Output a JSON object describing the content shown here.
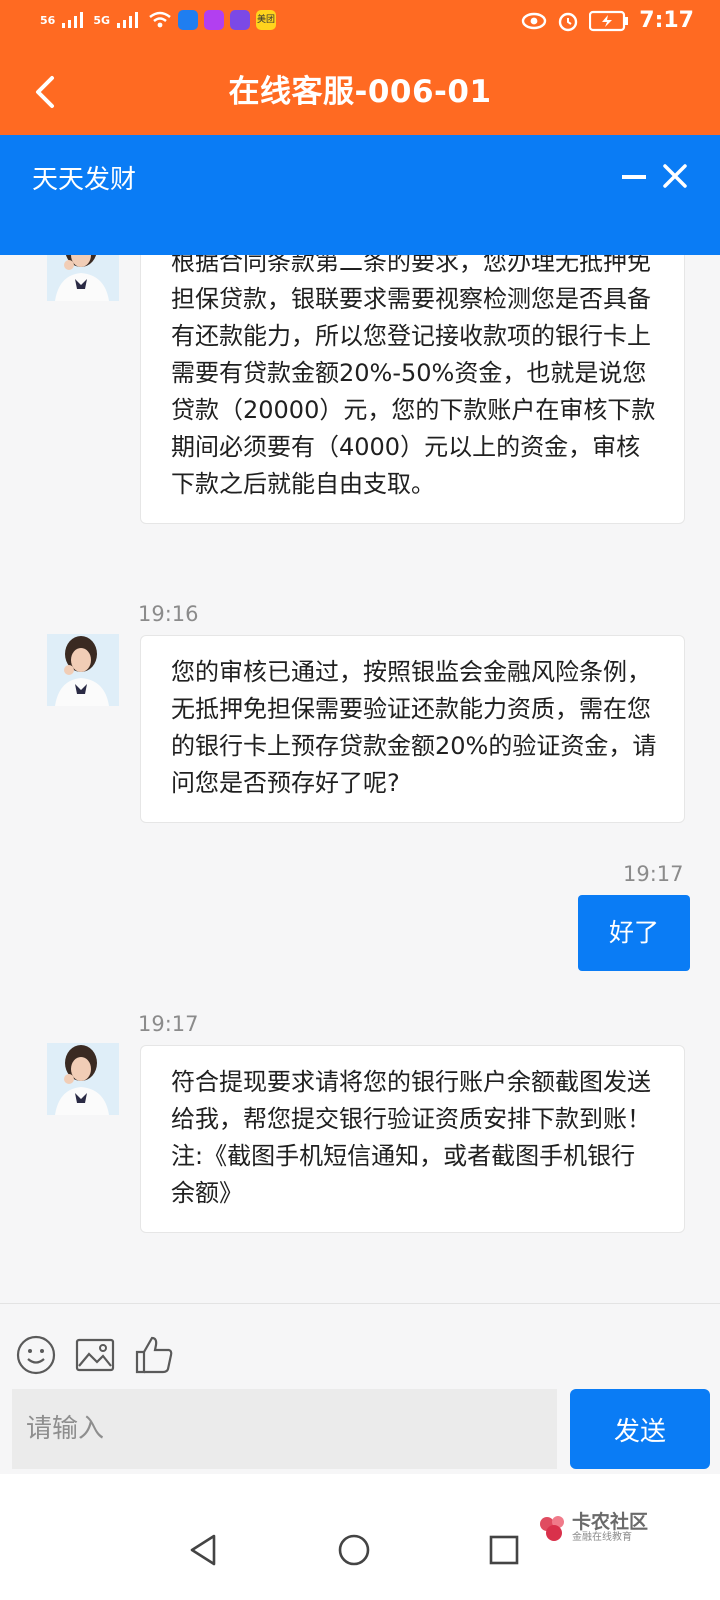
{
  "status_bar": {
    "signal_left": "56",
    "signal_right": "5G",
    "app_badge": "美团",
    "time": "7:17"
  },
  "header": {
    "title": "在线客服-006-01"
  },
  "banner": {
    "title": "天天发财"
  },
  "messages": [
    {
      "from": "agent",
      "time": "",
      "text": "根据合同条款第二条的要求，您办理无抵押免担保贷款，银联要求需要视察检测您是否具备有还款能力，所以您登记接收款项的银行卡上需要有贷款金额20%-50%资金，也就是说您贷款（20000）元，您的下款账户在审核下款期间必须要有（4000）元以上的资金，审核下款之后就能自由支取。"
    },
    {
      "from": "agent",
      "time": "19:16",
      "text": "您的审核已通过，按照银监会金融风险条例，无抵押免担保需要验证还款能力资质，需在您的银行卡上预存贷款金额20%的验证资金，请问您是否预存好了呢?"
    },
    {
      "from": "user",
      "time": "19:17",
      "text": "好了"
    },
    {
      "from": "agent",
      "time": "19:17",
      "text": "符合提现要求请将您的银行账户余额截图发送给我，帮您提交银行验证资质安排下款到账！注:《截图手机短信通知，或者截图手机银行余额》"
    }
  ],
  "composer": {
    "placeholder": "请输入",
    "send_label": "发送"
  },
  "watermark": {
    "main": "卡农社区",
    "sub": "金融在线教育"
  },
  "colors": {
    "header": "#ff6a22",
    "banner": "#0a7cf5",
    "send": "#0a7cf5"
  }
}
